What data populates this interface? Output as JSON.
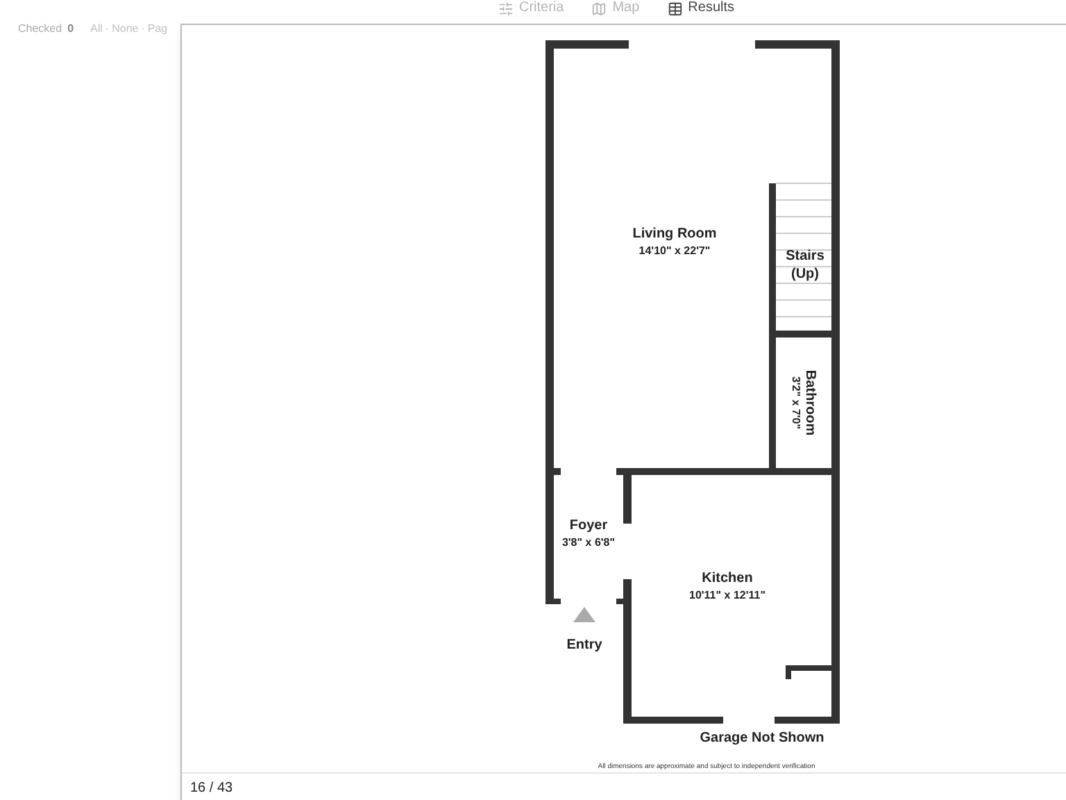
{
  "tabs": [
    {
      "kind": "sliders",
      "label": "Criteria",
      "selected": false
    },
    {
      "kind": "map",
      "label": "Map",
      "selected": false
    },
    {
      "kind": "grid",
      "label": "Results",
      "selected": true
    }
  ],
  "selection": {
    "label": "Checked",
    "count": "0",
    "links": [
      "All",
      "None",
      "Pag"
    ],
    "separator": "·"
  },
  "viewer": {
    "floor_plan": {
      "rooms": [
        {
          "name": "Living Room",
          "size": "14'10\" x 22'7\""
        },
        {
          "name": "Foyer",
          "size": "3'8\" x 6'8\""
        },
        {
          "name": "Kitchen",
          "size": "10'11\" x 12'11\""
        },
        {
          "name": "Bathroom",
          "size": "3'2\" x 7'0\""
        }
      ],
      "stairs": [
        "Stairs",
        "(Up)"
      ],
      "entry": "Entry",
      "garage_note": "Garage Not Shown",
      "disclaimer": "All dimensions are approximate and subject to independent verification"
    },
    "counter": "16 / 43"
  }
}
